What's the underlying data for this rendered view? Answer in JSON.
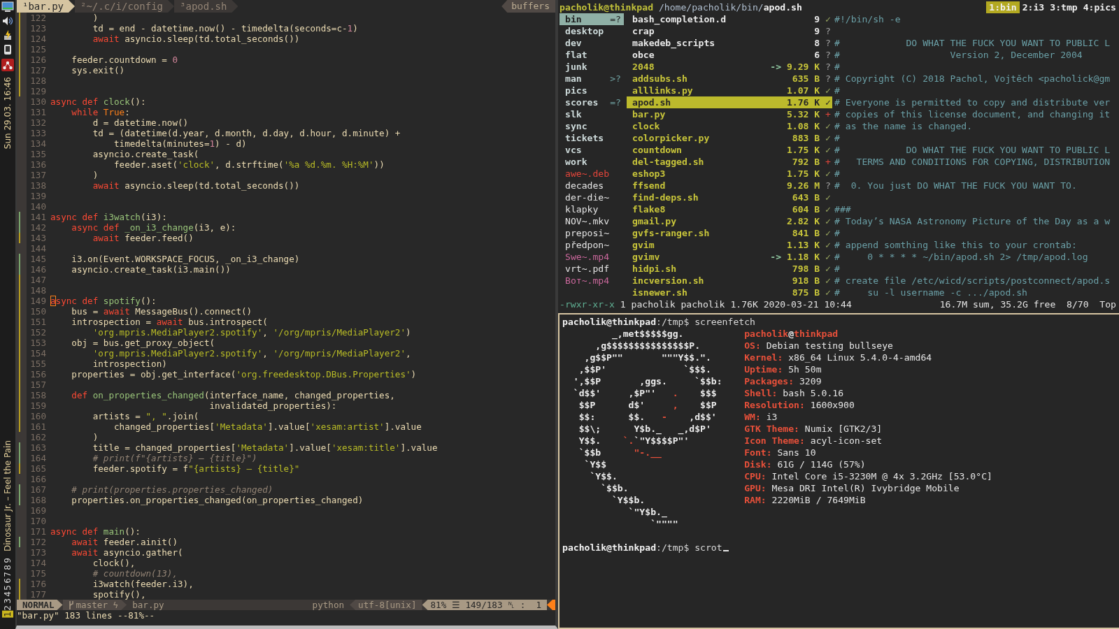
{
  "bar": {
    "clock": "Sun 29.03. 16:46",
    "song": "Dinosaur Jr. – Feel the Pain",
    "workspaces": [
      {
        "label": "1",
        "selected": true
      },
      {
        "label": "2",
        "selected": false
      },
      {
        "label": "3",
        "selected": false
      },
      {
        "label": "4",
        "selected": false
      },
      {
        "label": "5",
        "selected": false
      },
      {
        "label": "6",
        "selected": false
      },
      {
        "label": "7",
        "selected": false
      },
      {
        "label": "8",
        "selected": false
      },
      {
        "label": "9",
        "selected": false
      }
    ]
  },
  "vim": {
    "tabs": [
      {
        "label": "¹bar.py",
        "selected": true
      },
      {
        "label": "²~/.c/i/config",
        "selected": false
      },
      {
        "label": "³apod.sh",
        "selected": false
      }
    ],
    "buffers_label": "buffers",
    "lines": [
      {
        "n": "122",
        "color": "#b59e1e",
        "code": [
          {
            "kind": "plain",
            "text": "        )"
          }
        ]
      },
      {
        "n": "123",
        "color": "#b59e1e",
        "code": [
          {
            "kind": "plain",
            "text": "        td = end - datetime.now() - timedelta(seconds=c-"
          },
          {
            "kind": "number",
            "text": "1"
          },
          {
            "kind": "plain",
            "text": ")"
          }
        ]
      },
      {
        "n": "124",
        "color": "#b59e1e",
        "code": [
          {
            "kind": "keyword",
            "text": "        await"
          },
          {
            "kind": "plain",
            "text": " asyncio.sleep(td.total_seconds())"
          }
        ]
      },
      {
        "n": "125",
        "color": "#b59e1e"
      },
      {
        "n": "126",
        "color": "#b59e1e",
        "code": [
          {
            "kind": "plain",
            "text": "    feeder.countdown = "
          },
          {
            "kind": "number",
            "text": "0"
          }
        ]
      },
      {
        "n": "127",
        "color": "#b59e1e",
        "code": [
          {
            "kind": "plain",
            "text": "    sys.exit()"
          }
        ]
      },
      {
        "n": "128",
        "color": "#b59e1e"
      },
      {
        "n": "129",
        "color": "#b59e1e"
      },
      {
        "n": "130",
        "code": [
          {
            "kind": "keyword",
            "text": "async def "
          },
          {
            "kind": "function",
            "text": "clock"
          },
          {
            "kind": "plain",
            "text": "():"
          }
        ]
      },
      {
        "n": "131",
        "code": [
          {
            "kind": "keyword",
            "text": "    while "
          },
          {
            "kind": "constant",
            "text": "True"
          },
          {
            "kind": "plain",
            "text": ":"
          }
        ]
      },
      {
        "n": "132",
        "code": [
          {
            "kind": "plain",
            "text": "        d = datetime.now()"
          }
        ]
      },
      {
        "n": "133",
        "code": [
          {
            "kind": "plain",
            "text": "        td = (datetime(d.year, d.month, d.day, d.hour, d.minute) +"
          }
        ]
      },
      {
        "n": "134",
        "code": [
          {
            "kind": "plain",
            "text": "            timedelta(minutes="
          },
          {
            "kind": "number",
            "text": "1"
          },
          {
            "kind": "plain",
            "text": ") - d)"
          }
        ]
      },
      {
        "n": "135",
        "code": [
          {
            "kind": "plain",
            "text": "        asyncio.create_task("
          }
        ]
      },
      {
        "n": "136",
        "code": [
          {
            "kind": "plain",
            "text": "            feeder.aset("
          },
          {
            "kind": "string",
            "text": "'clock'"
          },
          {
            "kind": "plain",
            "text": ", d.strftime("
          },
          {
            "kind": "string",
            "text": "'%a %d.%m. %H:%M'"
          },
          {
            "kind": "plain",
            "text": "))"
          }
        ]
      },
      {
        "n": "137",
        "code": [
          {
            "kind": "plain",
            "text": "        )"
          }
        ]
      },
      {
        "n": "138",
        "code": [
          {
            "kind": "keyword",
            "text": "        await"
          },
          {
            "kind": "plain",
            "text": " asyncio.sleep(td.total_seconds())"
          }
        ]
      },
      {
        "n": "139"
      },
      {
        "n": "140"
      },
      {
        "n": "141",
        "color": "#79a66b",
        "code": [
          {
            "kind": "keyword",
            "text": "async def "
          },
          {
            "kind": "function",
            "text": "i3watch"
          },
          {
            "kind": "plain",
            "text": "(i3):"
          }
        ]
      },
      {
        "n": "142",
        "color": "#79a66b",
        "code": [
          {
            "kind": "keyword",
            "text": "    async def "
          },
          {
            "kind": "function",
            "text": "_on_i3_change"
          },
          {
            "kind": "plain",
            "text": "(i3, e):"
          }
        ]
      },
      {
        "n": "143",
        "color": "#b59e1e",
        "code": [
          {
            "kind": "keyword",
            "text": "        await"
          },
          {
            "kind": "plain",
            "text": " feeder.feed()"
          }
        ]
      },
      {
        "n": "144"
      },
      {
        "n": "145",
        "color": "#79a66b",
        "code": [
          {
            "kind": "plain",
            "text": "    i3.on(Event.WORKSPACE_FOCUS, _on_i3_change)"
          }
        ]
      },
      {
        "n": "146",
        "color": "#79a66b",
        "code": [
          {
            "kind": "plain",
            "text": "    asyncio.create_task(i3.main())"
          }
        ]
      },
      {
        "n": "147",
        "color": "#b59e1e"
      },
      {
        "n": "148",
        "color": "#b59e1e"
      },
      {
        "n": "149",
        "color": "#b59e1e",
        "code": [
          {
            "kind": "cursor",
            "text": "a"
          },
          {
            "kind": "keyword",
            "text": "sync def "
          },
          {
            "kind": "function",
            "text": "spotify"
          },
          {
            "kind": "plain",
            "text": "():"
          }
        ]
      },
      {
        "n": "150",
        "color": "#b59e1e",
        "code": [
          {
            "kind": "plain",
            "text": "    bus = "
          },
          {
            "kind": "keyword",
            "text": "await"
          },
          {
            "kind": "plain",
            "text": " MessageBus().connect()"
          }
        ]
      },
      {
        "n": "151",
        "color": "#b59e1e",
        "code": [
          {
            "kind": "plain",
            "text": "    introspection = "
          },
          {
            "kind": "keyword",
            "text": "await"
          },
          {
            "kind": "plain",
            "text": " bus.introspect("
          }
        ]
      },
      {
        "n": "152",
        "color": "#b59e1e",
        "code": [
          {
            "kind": "string",
            "text": "        'org.mpris.MediaPlayer2.spotify'"
          },
          {
            "kind": "plain",
            "text": ", "
          },
          {
            "kind": "string",
            "text": "'/org/mpris/MediaPlayer2'"
          },
          {
            "kind": "plain",
            "text": ")"
          }
        ]
      },
      {
        "n": "153",
        "color": "#b59e1e",
        "code": [
          {
            "kind": "plain",
            "text": "    obj = bus.get_proxy_object("
          }
        ]
      },
      {
        "n": "154",
        "color": "#b59e1e",
        "code": [
          {
            "kind": "string",
            "text": "        'org.mpris.MediaPlayer2.spotify'"
          },
          {
            "kind": "plain",
            "text": ", "
          },
          {
            "kind": "string",
            "text": "'/org/mpris/MediaPlayer2'"
          },
          {
            "kind": "plain",
            "text": ","
          }
        ]
      },
      {
        "n": "155",
        "color": "#b59e1e",
        "code": [
          {
            "kind": "plain",
            "text": "        introspection)"
          }
        ]
      },
      {
        "n": "156",
        "color": "#b59e1e",
        "code": [
          {
            "kind": "plain",
            "text": "    properties = obj.get_interface("
          },
          {
            "kind": "string",
            "text": "'org.freedesktop.DBus.Properties'"
          },
          {
            "kind": "plain",
            "text": ")"
          }
        ]
      },
      {
        "n": "157",
        "color": "#b59e1e"
      },
      {
        "n": "158",
        "color": "#b59e1e",
        "code": [
          {
            "kind": "keyword",
            "text": "    def "
          },
          {
            "kind": "function",
            "text": "on_properties_changed"
          },
          {
            "kind": "plain",
            "text": "(interface_name, changed_properties,"
          }
        ]
      },
      {
        "n": "159",
        "color": "#b59e1e",
        "code": [
          {
            "kind": "plain",
            "text": "                              invalidated_properties):"
          }
        ]
      },
      {
        "n": "160",
        "color": "#b59e1e",
        "code": [
          {
            "kind": "plain",
            "text": "        artists = "
          },
          {
            "kind": "string",
            "text": "\", \""
          },
          {
            "kind": "plain",
            "text": ".join("
          }
        ]
      },
      {
        "n": "161",
        "color": "#b59e1e",
        "code": [
          {
            "kind": "plain",
            "text": "            changed_properties["
          },
          {
            "kind": "string",
            "text": "'Metadata'"
          },
          {
            "kind": "plain",
            "text": "].value["
          },
          {
            "kind": "string",
            "text": "'xesam:artist'"
          },
          {
            "kind": "plain",
            "text": "].value"
          }
        ]
      },
      {
        "n": "162",
        "code": [
          {
            "kind": "plain",
            "text": "        )"
          }
        ]
      },
      {
        "n": "163",
        "color": "#79a66b",
        "code": [
          {
            "kind": "plain",
            "text": "        title = changed_properties["
          },
          {
            "kind": "string",
            "text": "'Metadata'"
          },
          {
            "kind": "plain",
            "text": "].value["
          },
          {
            "kind": "string",
            "text": "'xesam:title'"
          },
          {
            "kind": "plain",
            "text": "].value"
          }
        ]
      },
      {
        "n": "164",
        "color": "#79a66b",
        "code": [
          {
            "kind": "comment",
            "text": "        # print(f\"{artists} — {title}\")"
          }
        ]
      },
      {
        "n": "165",
        "color": "#b59e1e",
        "code": [
          {
            "kind": "plain",
            "text": "        feeder.spotify = f"
          },
          {
            "kind": "string",
            "text": "\"{artists} — {title}\""
          }
        ]
      },
      {
        "n": "166"
      },
      {
        "n": "167",
        "color": "#79a66b",
        "code": [
          {
            "kind": "comment",
            "text": "    # print(properties.properties_changed)"
          }
        ]
      },
      {
        "n": "168",
        "color": "#79a66b",
        "code": [
          {
            "kind": "plain",
            "text": "    properties.on_properties_changed(on_properties_changed)"
          }
        ]
      },
      {
        "n": "169"
      },
      {
        "n": "170"
      },
      {
        "n": "171",
        "code": [
          {
            "kind": "keyword",
            "text": "async def "
          },
          {
            "kind": "function",
            "text": "main"
          },
          {
            "kind": "plain",
            "text": "():"
          }
        ]
      },
      {
        "n": "172",
        "color": "#79a66b",
        "code": [
          {
            "kind": "keyword",
            "text": "    await"
          },
          {
            "kind": "plain",
            "text": " feeder.ainit()"
          }
        ]
      },
      {
        "n": "173",
        "code": [
          {
            "kind": "keyword",
            "text": "    await"
          },
          {
            "kind": "plain",
            "text": " asyncio.gather("
          }
        ]
      },
      {
        "n": "174",
        "code": [
          {
            "kind": "plain",
            "text": "        clock(),"
          }
        ]
      },
      {
        "n": "175",
        "code": [
          {
            "kind": "comment",
            "text": "        # countdown(13),"
          }
        ]
      },
      {
        "n": "176",
        "color": "#b59e1e",
        "code": [
          {
            "kind": "plain",
            "text": "        i3watch(feeder.i3),"
          }
        ]
      },
      {
        "n": "177",
        "color": "#b59e1e",
        "code": [
          {
            "kind": "plain",
            "text": "        spotify(),"
          }
        ]
      }
    ],
    "status": {
      "mode": "NORMAL",
      "branch": "master ϟ",
      "file": "bar.py",
      "filetype": "python",
      "encoding": "utf-8[unix]",
      "ruler": "81% ☰ 149/183 ␤ :  1"
    },
    "message": "\"bar.py\" 183 lines --81%--"
  },
  "ranger": {
    "host": "pacholik@thinkpad",
    "path": " /home/pacholik/bin/",
    "file": "apod.sh",
    "tabs": [
      {
        "label": "1:bin",
        "selected": true
      },
      {
        "label": "2:i3",
        "selected": false
      },
      {
        "label": "3:tmp",
        "selected": false
      },
      {
        "label": "4:pics",
        "selected": false
      }
    ],
    "parent": [
      {
        "name": "bin",
        "tag": "=?",
        "kind": "dir",
        "selected": true
      },
      {
        "name": "desktop",
        "kind": "dir",
        "selected": false
      },
      {
        "name": "dev",
        "kind": "dir",
        "selected": false
      },
      {
        "name": "flat",
        "kind": "dir",
        "selected": false
      },
      {
        "name": "junk",
        "kind": "dir",
        "selected": false
      },
      {
        "name": "man",
        "tag": ">?",
        "kind": "dir",
        "selected": false
      },
      {
        "name": "pics",
        "kind": "dir",
        "selected": false
      },
      {
        "name": "scores",
        "tag": "=?",
        "kind": "dir",
        "selected": false
      },
      {
        "name": "slk",
        "kind": "dir",
        "selected": false
      },
      {
        "name": "sync",
        "kind": "dir",
        "selected": false
      },
      {
        "name": "tickets",
        "kind": "dir",
        "selected": false
      },
      {
        "name": "vcs",
        "kind": "dir",
        "selected": false
      },
      {
        "name": "work",
        "kind": "dir",
        "selected": false
      },
      {
        "name": "awe~.deb",
        "kind": "package",
        "selected": false
      },
      {
        "name": "decades",
        "kind": "file",
        "selected": false
      },
      {
        "name": "der-die~",
        "kind": "file",
        "selected": false
      },
      {
        "name": "klapky",
        "kind": "file",
        "selected": false
      },
      {
        "name": "NOV~.mkv",
        "kind": "file",
        "selected": false
      },
      {
        "name": "preposi~",
        "kind": "file",
        "selected": false
      },
      {
        "name": "předpon~",
        "kind": "file",
        "selected": false
      },
      {
        "name": "Swe~.mp4",
        "kind": "video",
        "selected": false
      },
      {
        "name": "vrt~.pdf",
        "kind": "file",
        "selected": false
      },
      {
        "name": "Bот~.mp4",
        "kind": "video",
        "selected": false
      }
    ],
    "files": [
      {
        "name": "bash_completion.d",
        "size": "9",
        "mark": "✓",
        "kind": "dir",
        "selected": false,
        "preview": "#!/bin/sh -e"
      },
      {
        "name": "crap",
        "size": "9",
        "mark": "?",
        "kind": "dir",
        "selected": false
      },
      {
        "name": "makedeb_scripts",
        "size": "8",
        "mark": "?",
        "kind": "dir",
        "selected": false,
        "preview": "#            DO WHAT THE FUCK YOU WANT TO PUBLIC L"
      },
      {
        "name": "obce",
        "size": "6",
        "mark": "?",
        "kind": "dir",
        "selected": false,
        "preview": "#                    Version 2, December 2004"
      },
      {
        "name": "2048",
        "arrow": "->",
        "size": "9.29 K",
        "mark": "?",
        "kind": "exec",
        "selected": false,
        "preview": "#"
      },
      {
        "name": "addsubs.sh",
        "size": "635 B",
        "mark": "?",
        "kind": "exec",
        "selected": false,
        "preview": "# Copyright (C) 2018 Pachol, Vojtěch <pacholick@gm"
      },
      {
        "name": "alllinks.py",
        "size": "1.07 K",
        "mark": "✓",
        "kind": "exec",
        "selected": false,
        "preview": "#"
      },
      {
        "name": "apod.sh",
        "size": "1.76 K",
        "mark": "✓",
        "kind": "exec",
        "selected": true,
        "preview": "# Everyone is permitted to copy and distribute ver"
      },
      {
        "name": "bar.py",
        "size": "5.32 K",
        "mark": "+",
        "kind": "exec",
        "selected": false,
        "preview": "# copies of this license document, and changing it"
      },
      {
        "name": "clock",
        "size": "1.08 K",
        "mark": "✓",
        "kind": "exec",
        "selected": false,
        "preview": "# as the name is changed."
      },
      {
        "name": "colorpicker.py",
        "size": "883 B",
        "mark": "✓",
        "kind": "exec",
        "selected": false,
        "preview": "#"
      },
      {
        "name": "countdown",
        "size": "1.75 K",
        "mark": "✓",
        "kind": "exec",
        "selected": false,
        "preview": "#            DO WHAT THE FUCK YOU WANT TO PUBLIC L"
      },
      {
        "name": "del-tagged.sh",
        "size": "792 B",
        "mark": "+",
        "kind": "exec",
        "selected": false,
        "preview": "#   TERMS AND CONDITIONS FOR COPYING, DISTRIBUTION"
      },
      {
        "name": "eshop3",
        "size": "1.75 K",
        "mark": "✓",
        "kind": "exec",
        "selected": false,
        "preview": "#"
      },
      {
        "name": "ffsend",
        "size": "9.26 M",
        "mark": "?",
        "kind": "exec",
        "selected": false,
        "preview": "#  0. You just DO WHAT THE FUCK YOU WANT TO."
      },
      {
        "name": "find-deps.sh",
        "size": "643 B",
        "mark": "✓",
        "kind": "exec",
        "selected": false
      },
      {
        "name": "flake8",
        "size": "604 B",
        "mark": "✓",
        "kind": "exec",
        "selected": false,
        "preview": "###"
      },
      {
        "name": "gmail.py",
        "size": "2.82 K",
        "mark": "✓",
        "kind": "exec",
        "selected": false,
        "preview": "# Today’s NASA Astronomy Picture of the Day as a w"
      },
      {
        "name": "gvfs-ranger.sh",
        "size": "841 B",
        "mark": "✓",
        "kind": "exec",
        "selected": false,
        "preview": "#"
      },
      {
        "name": "gvim",
        "size": "1.13 K",
        "mark": "✓",
        "kind": "exec",
        "selected": false,
        "preview": "# append somthing like this to your crontab:"
      },
      {
        "name": "gvimv",
        "arrow": "->",
        "size": "1.18 K",
        "mark": "✓",
        "kind": "exec",
        "selected": false,
        "preview": "#     0 * * * * ~/bin/apod.sh 2> /tmp/apod.log"
      },
      {
        "name": "hidpi.sh",
        "size": "798 B",
        "mark": "✓",
        "kind": "exec",
        "selected": false,
        "preview": "#"
      },
      {
        "name": "incversion.sh",
        "size": "918 B",
        "mark": "✓",
        "kind": "exec",
        "selected": false,
        "preview": "# create file /etc/wicd/scripts/postconnect/apod.s"
      },
      {
        "name": "isnewer.sh",
        "size": "875 B",
        "mark": "✓",
        "kind": "exec",
        "selected": false,
        "preview": "#     su -l username -c .../apod.sh"
      }
    ],
    "status": {
      "perms": "-rwxr-xr-x",
      "info": " 1 pacholik pacholik 1.76K 2020-03-21 10:44",
      "summary": "16.7M sum, 35.2G free",
      "position": "8/70",
      "scroll": "Top"
    }
  },
  "terminal": {
    "first_prompt": {
      "user": "pacholik@thinkpad",
      "path": ":/tmp$ ",
      "command": "screenfetch"
    },
    "art": [
      [
        {
          "kind": "white",
          "text": "         _,met$$$$$gg."
        }
      ],
      [
        {
          "kind": "white",
          "text": "      ,g$$$$$$$$$$$$$$$P."
        }
      ],
      [
        {
          "kind": "white",
          "text": "    ,g$$P\"\"       \"\"\"Y$$.\"."
        }
      ],
      [
        {
          "kind": "white",
          "text": "   ,$$P'              `$$$."
        }
      ],
      [
        {
          "kind": "white",
          "text": "  ',$$P       ,ggs.     `$$b:"
        }
      ],
      [
        {
          "kind": "white",
          "text": "  `d$$'     ,$P\"'   "
        },
        {
          "kind": "red",
          "text": "."
        },
        {
          "kind": "white",
          "text": "    $$$"
        }
      ],
      [
        {
          "kind": "white",
          "text": "   $$P      d$'     "
        },
        {
          "kind": "red",
          "text": ","
        },
        {
          "kind": "white",
          "text": "    $$P"
        }
      ],
      [
        {
          "kind": "white",
          "text": "   $$:      $$.   "
        },
        {
          "kind": "red",
          "text": "-"
        },
        {
          "kind": "white",
          "text": "    ,d$$'"
        }
      ],
      [
        {
          "kind": "white",
          "text": "   $$\\;      Y$b._   _,d$P'"
        }
      ],
      [
        {
          "kind": "white",
          "text": "   Y$$.    "
        },
        {
          "kind": "red",
          "text": "`."
        },
        {
          "kind": "white",
          "text": "`\"Y$$$$P\"'"
        }
      ],
      [
        {
          "kind": "white",
          "text": "   `$$b      "
        },
        {
          "kind": "red",
          "text": "\"-.__"
        }
      ],
      [
        {
          "kind": "white",
          "text": "    `Y$$"
        }
      ],
      [
        {
          "kind": "white",
          "text": "     `Y$$."
        }
      ],
      [
        {
          "kind": "white",
          "text": "       `$$b."
        }
      ],
      [
        {
          "kind": "white",
          "text": "         `Y$$b."
        }
      ],
      [
        {
          "kind": "white",
          "text": "            `\"Y$b._"
        }
      ],
      [
        {
          "kind": "white",
          "text": "                `\"\"\"\""
        }
      ]
    ],
    "title": [
      {
        "kind": "red",
        "text": "pacholik"
      },
      {
        "kind": "white",
        "text": "@"
      },
      {
        "kind": "red",
        "text": "thinkpad"
      }
    ],
    "info": [
      {
        "label": "OS:",
        "value": " Debian testing bullseye"
      },
      {
        "label": "Kernel:",
        "value": " x86_64 Linux 5.4.0-4-amd64"
      },
      {
        "label": "Uptime:",
        "value": " 5h 50m"
      },
      {
        "label": "Packages:",
        "value": " 3209"
      },
      {
        "label": "Shell:",
        "value": " bash 5.0.16"
      },
      {
        "label": "Resolution:",
        "value": " 1600x900"
      },
      {
        "label": "WM:",
        "value": " i3"
      },
      {
        "label": "GTK Theme:",
        "value": " Numix [GTK2/3]"
      },
      {
        "label": "Icon Theme:",
        "value": " acyl-icon-set"
      },
      {
        "label": "Font:",
        "value": " Sans 10"
      },
      {
        "label": "Disk:",
        "value": " 61G / 114G (57%)"
      },
      {
        "label": "CPU:",
        "value": " Intel Core i5-3230M @ 4x 3.2GHz [53.0°C]"
      },
      {
        "label": "GPU:",
        "value": " Mesa DRI Intel(R) Ivybridge Mobile"
      },
      {
        "label": "RAM:",
        "value": " 2220MiB / 7649MiB"
      }
    ],
    "last_prompt": {
      "user": "pacholik@thinkpad",
      "path": ":/tmp$ ",
      "command": "scrot"
    }
  }
}
